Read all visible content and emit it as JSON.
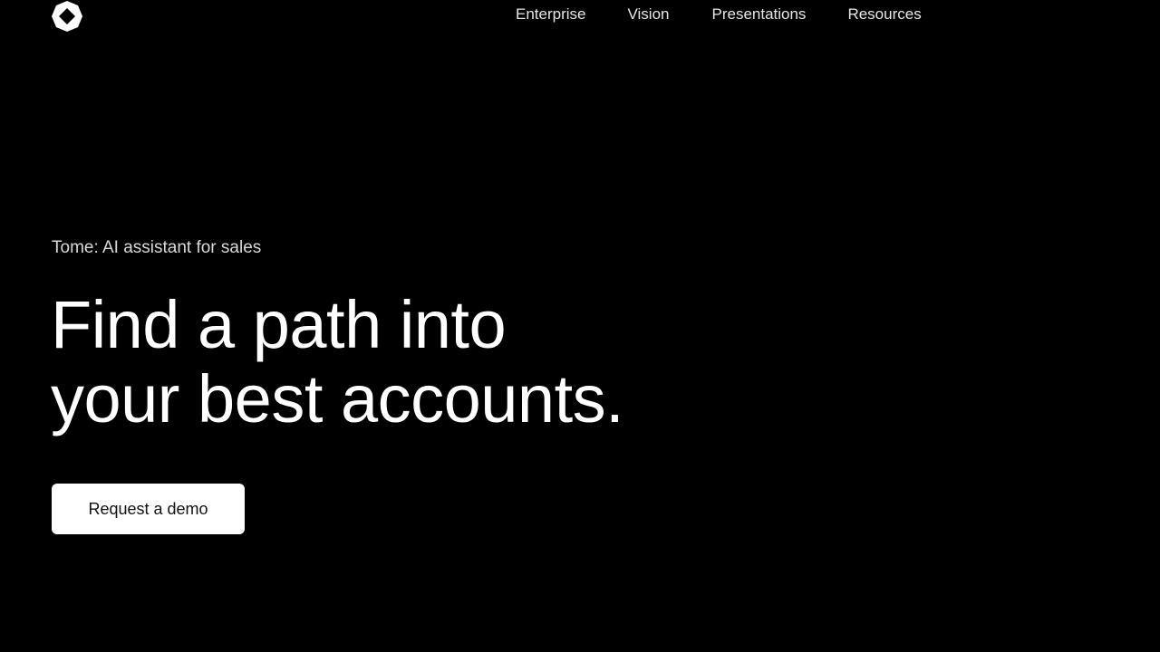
{
  "header": {
    "logo_icon": "tome-logo-icon",
    "nav": [
      {
        "label": "Enterprise"
      },
      {
        "label": "Vision"
      },
      {
        "label": "Presentations"
      },
      {
        "label": "Resources"
      }
    ]
  },
  "hero": {
    "eyebrow": "Tome: AI assistant for sales",
    "headline_line1": "Find a path into",
    "headline_line2": "your best accounts.",
    "cta_label": "Request a demo"
  },
  "colors": {
    "background": "#000000",
    "text": "#ffffff",
    "button_bg": "#ffffff",
    "button_text": "#111111"
  }
}
